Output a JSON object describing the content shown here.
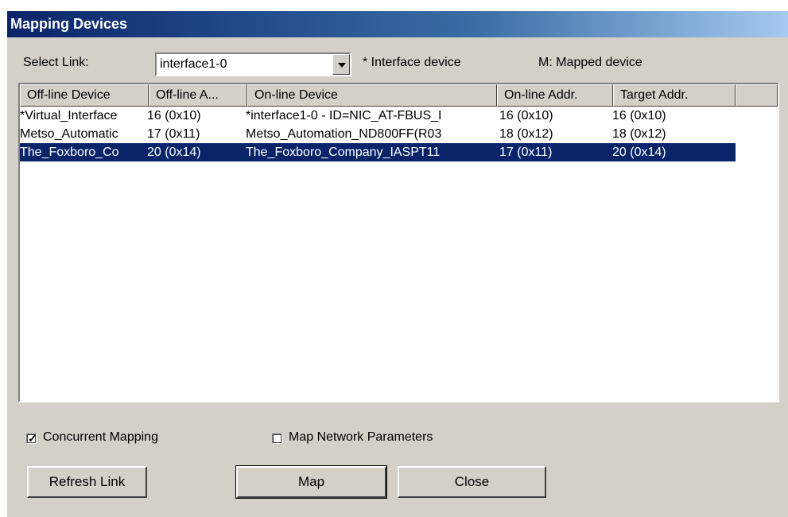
{
  "window": {
    "title": "Mapping Devices"
  },
  "select_link": {
    "label": "Select Link:",
    "value": "interface1-0"
  },
  "legend": {
    "interface": "* Interface device",
    "mapped": "M: Mapped device"
  },
  "table": {
    "columns": [
      "Off-line Device",
      "Off-line A...",
      "On-line Device",
      "On-line Addr.",
      "Target Addr."
    ],
    "rows": [
      [
        "*Virtual_Interface",
        "16 (0x10)",
        "*interface1-0 - ID=NIC_AT-FBUS_I",
        "16 (0x10)",
        "16 (0x10)"
      ],
      [
        "Metso_Automatic",
        "17 (0x11)",
        "Metso_Automation_ND800FF(R03",
        "18 (0x12)",
        "18 (0x12)"
      ],
      [
        "The_Foxboro_Co",
        "20 (0x14)",
        "The_Foxboro_Company_IASPT11",
        "17 (0x11)",
        "20 (0x14)"
      ]
    ],
    "selected_row": 2
  },
  "options": {
    "concurrent_mapping": {
      "label": "Concurrent Mapping",
      "checked": true
    },
    "map_network_parameters": {
      "label": "Map Network Parameters",
      "checked": false
    }
  },
  "buttons": {
    "refresh": "Refresh Link",
    "map": "Map",
    "close": "Close"
  },
  "colors": {
    "selection": "#0a246a",
    "dialog_bg": "#d4d0c8"
  }
}
